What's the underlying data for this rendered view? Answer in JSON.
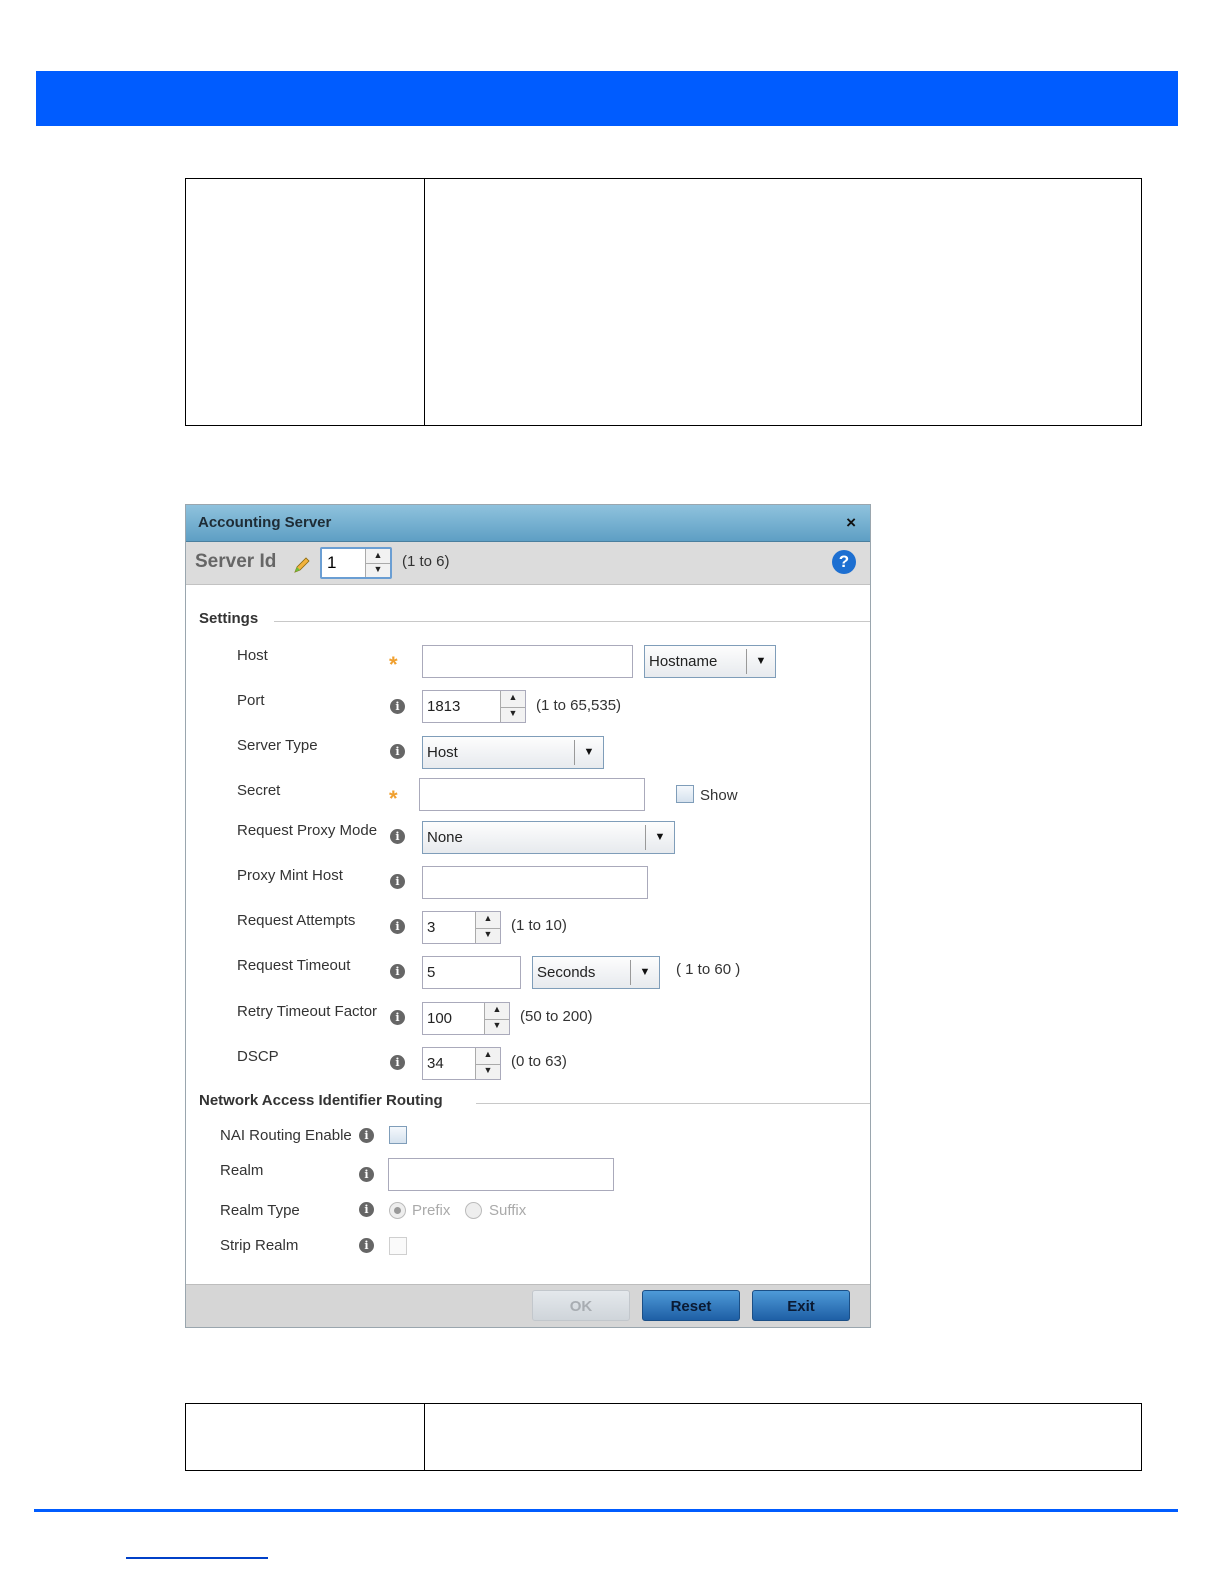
{
  "dialog": {
    "title": "Accounting Server",
    "close_glyph": "×",
    "server_id_label": "Server Id",
    "server_id_value": "1",
    "server_id_range": "(1 to 6)",
    "help_glyph": "?",
    "settings_section": "Settings",
    "nai_section": "Network Access Identifier Routing",
    "fields": {
      "host": {
        "label": "Host",
        "value": "",
        "type_select": "Hostname"
      },
      "port": {
        "label": "Port",
        "value": "1813",
        "range": "(1 to 65,535)"
      },
      "server_type": {
        "label": "Server Type",
        "value": "Host"
      },
      "secret": {
        "label": "Secret",
        "value": "",
        "show_label": "Show"
      },
      "request_proxy_mode": {
        "label": "Request Proxy Mode",
        "value": "None"
      },
      "proxy_mint_host": {
        "label": "Proxy Mint Host",
        "value": ""
      },
      "request_attempts": {
        "label": "Request Attempts",
        "value": "3",
        "range": "(1 to 10)"
      },
      "request_timeout": {
        "label": "Request Timeout",
        "value": "5",
        "unit": "Seconds",
        "range": "( 1 to 60 )"
      },
      "retry_timeout_factor": {
        "label": "Retry Timeout Factor",
        "value": "100",
        "range": "(50 to 200)"
      },
      "dscp": {
        "label": "DSCP",
        "value": "34",
        "range": "(0 to 63)"
      },
      "nai_routing_enable": {
        "label": "NAI Routing Enable"
      },
      "realm": {
        "label": "Realm",
        "value": ""
      },
      "realm_type": {
        "label": "Realm Type",
        "options": [
          "Prefix",
          "Suffix"
        ],
        "selected": "Prefix"
      },
      "strip_realm": {
        "label": "Strip Realm"
      }
    },
    "buttons": {
      "ok": "OK",
      "reset": "Reset",
      "exit": "Exit"
    }
  },
  "glyphs": {
    "info": "i",
    "required": "*",
    "arrow_down": "▼",
    "arrow_up": "▲"
  },
  "colors": {
    "header_bar": "#005cff",
    "title_bar": "#6fa9cb",
    "button_blue": "#2e73b8",
    "required_star": "#f0a030"
  }
}
